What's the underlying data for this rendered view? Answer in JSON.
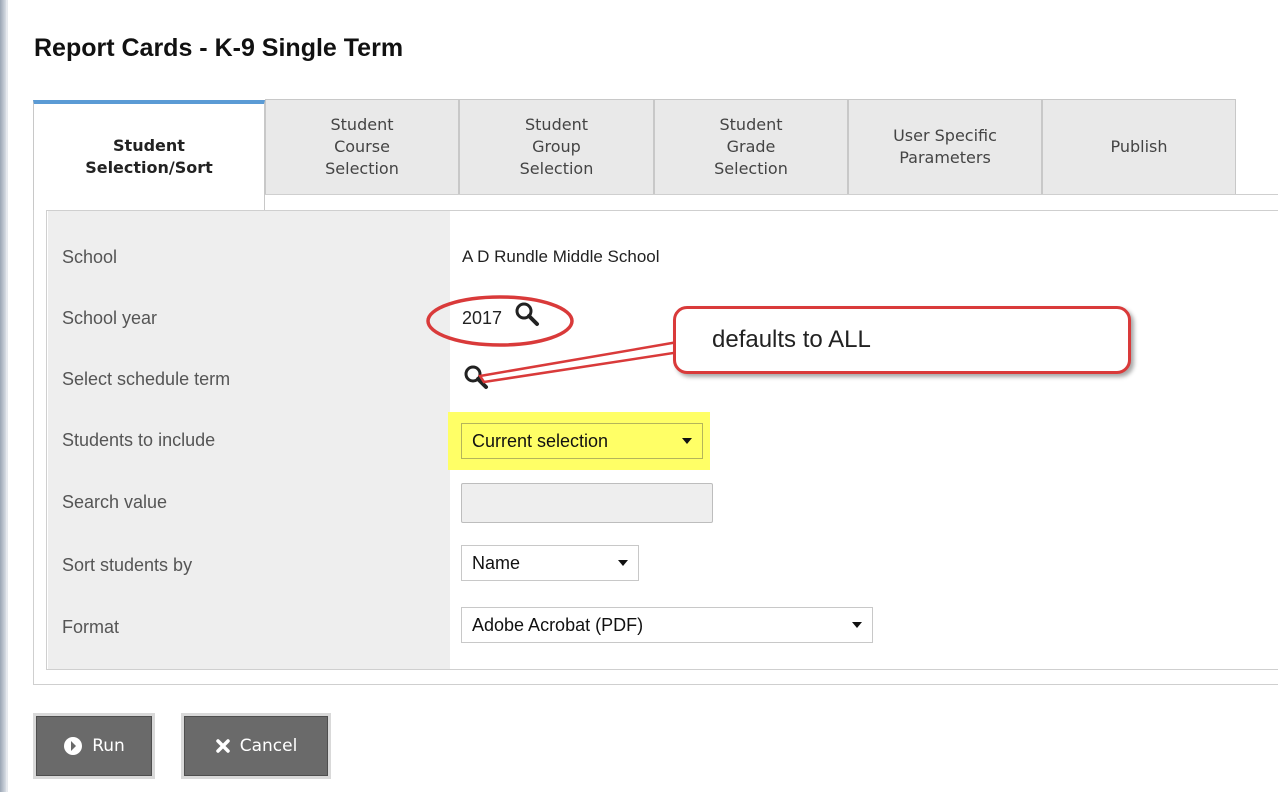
{
  "page": {
    "title": "Report Cards - K-9 Single Term"
  },
  "tabs": [
    {
      "label": "Student\nSelection/Sort",
      "active": true
    },
    {
      "label": "Student\nCourse\nSelection",
      "active": false
    },
    {
      "label": "Student\nGroup\nSelection",
      "active": false
    },
    {
      "label": "Student\nGrade\nSelection",
      "active": false
    },
    {
      "label": "User Specific\nParameters",
      "active": false
    },
    {
      "label": "Publish",
      "active": false
    }
  ],
  "form": {
    "rows": [
      {
        "label": "School"
      },
      {
        "label": "School year"
      },
      {
        "label": "Select schedule term"
      },
      {
        "label": "Students to include"
      },
      {
        "label": "Search value"
      },
      {
        "label": "Sort students by"
      },
      {
        "label": "Format"
      }
    ],
    "school_value": "A D Rundle Middle School",
    "school_year_value": "2017",
    "students_to_include_value": "Current selection",
    "search_value": "",
    "sort_by_value": "Name",
    "format_value": "Adobe Acrobat (PDF)"
  },
  "annotation": {
    "callout_text": "defaults to ALL",
    "circle_color": "#d93a3a",
    "highlight_color": "#ffff66"
  },
  "buttons": {
    "run_label": "Run",
    "cancel_label": "Cancel"
  },
  "colors": {
    "active_tab_accent": "#5b9bd5",
    "button_bg": "#6a6a6a"
  }
}
